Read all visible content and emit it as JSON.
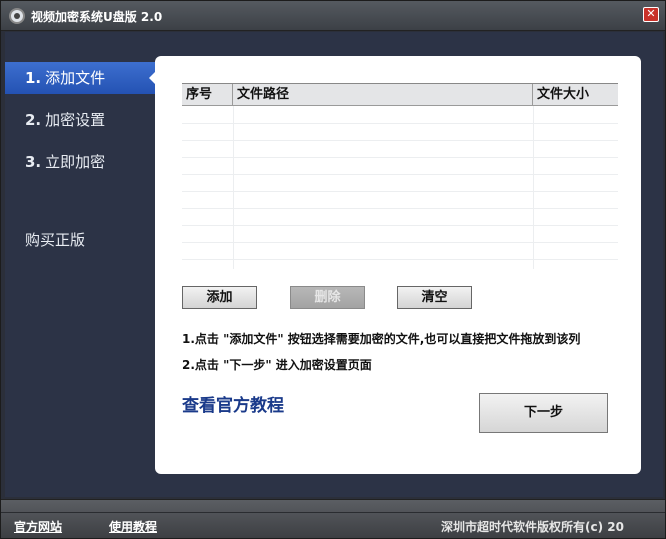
{
  "window": {
    "title": "视频加密系统U盘版 2.0",
    "close_glyph": "✕"
  },
  "sidebar": {
    "items": [
      {
        "num": "1.",
        "label": "添加文件",
        "active": true
      },
      {
        "num": "2.",
        "label": "加密设置",
        "active": false
      },
      {
        "num": "3.",
        "label": "立即加密",
        "active": false
      }
    ],
    "buy_label": "购买正版"
  },
  "table": {
    "columns": [
      "序号",
      "文件路径",
      "文件大小"
    ],
    "rows": []
  },
  "buttons": {
    "add": "添加",
    "delete": "删除",
    "clear": "清空",
    "next": "下一步"
  },
  "hints": {
    "line1": "1.点击 \"添加文件\" 按钮选择需要加密的文件,也可以直接把文件拖放到该列",
    "line2": "2.点击 \"下一步\" 进入加密设置页面"
  },
  "tutorial_link": "查看官方教程",
  "footer": {
    "site_link": "官方网站",
    "tutorial_link": "使用教程",
    "copyright": "深圳市超时代软件版权所有(c) 20"
  },
  "colors": {
    "accent": "#2b5ac0",
    "panel_bg": "#ffffff",
    "body_bg": "#2c3346"
  },
  "icons": {
    "app": "app-logo-icon",
    "close": "close-icon"
  }
}
